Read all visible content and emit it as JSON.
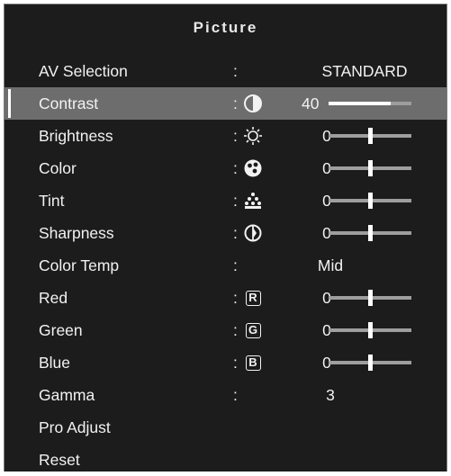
{
  "menu": {
    "title": "Picture",
    "colon": ":",
    "items": [
      {
        "label": "AV Selection",
        "value": "STANDARD"
      },
      {
        "label": "Contrast",
        "value": "40",
        "level": 0.75
      },
      {
        "label": "Brightness",
        "value": "0",
        "level": 0.5
      },
      {
        "label": "Color",
        "value": "0",
        "level": 0.5
      },
      {
        "label": "Tint",
        "value": "0",
        "level": 0.5
      },
      {
        "label": "Sharpness",
        "value": "0",
        "level": 0.5
      },
      {
        "label": "Color Temp",
        "value": "Mid"
      },
      {
        "label": "Red",
        "value": "0",
        "level": 0.5,
        "icon_letter": "R"
      },
      {
        "label": "Green",
        "value": "0",
        "level": 0.5,
        "icon_letter": "G"
      },
      {
        "label": "Blue",
        "value": "0",
        "level": 0.5,
        "icon_letter": "B"
      },
      {
        "label": "Gamma",
        "value": "3"
      },
      {
        "label": "Pro Adjust"
      },
      {
        "label": "Reset"
      }
    ]
  },
  "icons": [
    "contrast-icon",
    "brightness-icon",
    "color-icon",
    "tint-icon",
    "sharpness-icon",
    "red-icon",
    "green-icon",
    "blue-icon"
  ],
  "colors": {
    "background": "#1c1c1c",
    "highlight": "#6d6d6d",
    "text": "#f2f2f2",
    "slider_track": "#9e9e9e"
  }
}
